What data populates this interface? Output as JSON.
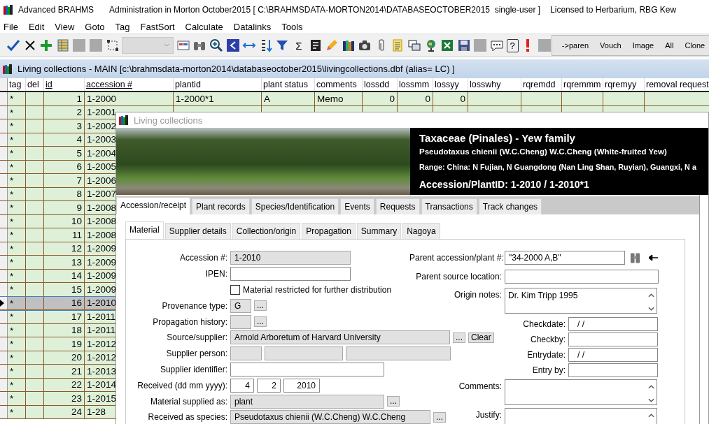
{
  "app_title": {
    "app": "Advanced BRAHMS",
    "context": "Administration in Morton October2015 [ C:\\BRAHMSDATA-MORTON2014\\DATABASEOCTOBER2015  single-user ]",
    "license": "Licensed to Herbarium, RBG Kew"
  },
  "menu": [
    "File",
    "Edit",
    "View",
    "Goto",
    "Tag",
    "FastSort",
    "Calculate",
    "Datalinks",
    "Tools"
  ],
  "toolbar": {
    "combo": {
      "disabled": true
    },
    "glyphs": [
      "Σ",
      "?"
    ],
    "text_buttons": [
      "->paren",
      "Vouch",
      "Image",
      "All",
      "Clone"
    ]
  },
  "table_window": {
    "title": "Living collections - MAIN [c:\\brahmsdata-morton2014\\databaseoctober2015\\livingcollections.dbf (alias= LC) ]"
  },
  "table": {
    "columns": [
      {
        "label": "tag",
        "underlined": false
      },
      {
        "label": "del",
        "underlined": false
      },
      {
        "label": "id",
        "underlined": true
      },
      {
        "label": "accession #",
        "underlined": true
      },
      {
        "label": "plantid",
        "underlined": false
      },
      {
        "label": "plant status",
        "underlined": false
      },
      {
        "label": "comments",
        "underlined": false
      },
      {
        "label": "lossdd",
        "underlined": false
      },
      {
        "label": "lossmm",
        "underlined": false
      },
      {
        "label": "lossyy",
        "underlined": false
      },
      {
        "label": "losswhy",
        "underlined": false
      },
      {
        "label": "rqremdd",
        "underlined": false
      },
      {
        "label": "rqremmm",
        "underlined": false
      },
      {
        "label": "rqremyy",
        "underlined": false
      },
      {
        "label": "removal request",
        "underlined": false
      }
    ],
    "rows": [
      {
        "selected": false,
        "tag": "*",
        "id": "1",
        "accession": "1-2000",
        "plantid": "1-2000*1",
        "plant_status": "A",
        "comments": "Memo",
        "lossdd": "0",
        "lossmm": "0",
        "lossyy": "0"
      },
      {
        "selected": false,
        "tag": "*",
        "id": "2",
        "accession": "1-2001"
      },
      {
        "selected": false,
        "tag": "*",
        "id": "3",
        "accession": "1-2002"
      },
      {
        "selected": false,
        "tag": "*",
        "id": "4",
        "accession": "1-2003"
      },
      {
        "selected": false,
        "tag": "*",
        "id": "5",
        "accession": "1-2004"
      },
      {
        "selected": false,
        "tag": "*",
        "id": "6",
        "accession": "1-2005"
      },
      {
        "selected": false,
        "tag": "*",
        "id": "7",
        "accession": "1-2006"
      },
      {
        "selected": false,
        "tag": "*",
        "id": "8",
        "accession": "1-2007"
      },
      {
        "selected": false,
        "tag": "*",
        "id": "9",
        "accession": "1-2008"
      },
      {
        "selected": false,
        "tag": "*",
        "id": "10",
        "accession": "1-2008"
      },
      {
        "selected": false,
        "tag": "*",
        "id": "11",
        "accession": "1-2008"
      },
      {
        "selected": false,
        "tag": "*",
        "id": "12",
        "accession": "1-2009"
      },
      {
        "selected": false,
        "tag": "*",
        "id": "13",
        "accession": "1-2009"
      },
      {
        "selected": false,
        "tag": "*",
        "id": "14",
        "accession": "1-2009"
      },
      {
        "selected": false,
        "tag": "*",
        "id": "15",
        "accession": "1-2009"
      },
      {
        "selected": true,
        "tag": "*",
        "id": "16",
        "accession": "1-2010"
      },
      {
        "selected": false,
        "tag": "*",
        "id": "17",
        "accession": "1-2011"
      },
      {
        "selected": false,
        "tag": "*",
        "id": "18",
        "accession": "1-2011"
      },
      {
        "selected": false,
        "tag": "*",
        "id": "19",
        "accession": "1-2012"
      },
      {
        "selected": false,
        "tag": "*",
        "id": "20",
        "accession": "1-2012"
      },
      {
        "selected": false,
        "tag": "*",
        "id": "21",
        "accession": "1-2013"
      },
      {
        "selected": false,
        "tag": "*",
        "id": "22",
        "accession": "1-2014"
      },
      {
        "selected": false,
        "tag": "*",
        "id": "23",
        "accession": "1-2015"
      },
      {
        "selected": false,
        "tag": "*",
        "id": "24",
        "accession": "1-28"
      }
    ]
  },
  "dialog": {
    "title": "Living collections",
    "header": {
      "family": "Taxaceae (Pinales) - Yew family",
      "species": "Pseudotaxus chienii (W.C.Cheng) W.C.Cheng (White-fruited Yew)",
      "range": "Range: China: N Fujian, N Guangdong (Nan Ling Shan, Ruyian), Guangxi, N a",
      "accession": "Accession/PlantID: 1-2010 / 1-2010*1"
    },
    "tabs": [
      {
        "label": "Accession/receipt",
        "selected": true
      },
      {
        "label": "Plant records",
        "selected": false
      },
      {
        "label": "Species/Identification",
        "selected": false
      },
      {
        "label": "Events",
        "selected": false
      },
      {
        "label": "Requests",
        "selected": false
      },
      {
        "label": "Transactions",
        "selected": false
      },
      {
        "label": "Track changes",
        "selected": false
      }
    ],
    "subtabs": [
      {
        "label": "Material",
        "selected": true
      },
      {
        "label": "Supplier details",
        "selected": false
      },
      {
        "label": "Collection/origin",
        "selected": false
      },
      {
        "label": "Propagation",
        "selected": false
      },
      {
        "label": "Summary",
        "selected": false
      },
      {
        "label": "Nagoya",
        "selected": false
      }
    ],
    "left_fields": [
      {
        "kind": "text",
        "label": "Accession #:",
        "value": "1-2010",
        "readonly": true
      },
      {
        "kind": "text",
        "label": "IPEN:",
        "readonly": false
      },
      {
        "kind": "checkbox",
        "label": "Material restricted for further distribution",
        "checked": false
      },
      {
        "kind": "lookup",
        "label": "Provenance type:",
        "value": "G",
        "readonly": true,
        "button": "..."
      },
      {
        "kind": "lookup",
        "label": "Propagation history:",
        "readonly": true,
        "button": "..."
      },
      {
        "kind": "lookup",
        "label": "Source/supplier:",
        "value": "Arnold Arboretum of Harvard University",
        "readonly": true,
        "button": "...",
        "extra_button": "Clear"
      },
      {
        "kind": "multi",
        "label": "Supplier person:",
        "parts": [
          {
            "readonly": true
          },
          {
            "readonly": true
          },
          {
            "readonly": true
          }
        ]
      },
      {
        "kind": "text",
        "label": "Supplier identifier:",
        "readonly": false
      },
      {
        "kind": "date",
        "label": "Received (dd mm yyyy):",
        "parts": [
          {
            "value": "4"
          },
          {
            "value": "2"
          },
          {
            "value": "2010"
          }
        ]
      },
      {
        "kind": "lookup",
        "label": "Material supplied as:",
        "value": "plant",
        "readonly": true,
        "button": "..."
      },
      {
        "kind": "lookup",
        "label": "Received as species:",
        "value": "Pseudotaxus chienii (W.C.Cheng) W.C.Cheng",
        "readonly": true,
        "button": "..."
      }
    ],
    "right_fields": [
      {
        "kind": "parent",
        "label": "Parent accession/plant #:",
        "value": "\"34-2000 A,B\""
      },
      {
        "kind": "text",
        "label": "Parent source location:"
      },
      {
        "kind": "memo",
        "label": "Origin notes:",
        "value": "Dr. Kim Tripp 1995"
      },
      {
        "kind": "small",
        "label": "Checkdate:",
        "value": "/ /"
      },
      {
        "kind": "small",
        "label": "Checkby:"
      },
      {
        "kind": "small",
        "label": "Entrydate:",
        "value": "/ /"
      },
      {
        "kind": "small",
        "label": "Entry by:"
      },
      {
        "kind": "memo",
        "label": "Comments:"
      },
      {
        "kind": "memo",
        "label": "Justify:"
      }
    ]
  }
}
